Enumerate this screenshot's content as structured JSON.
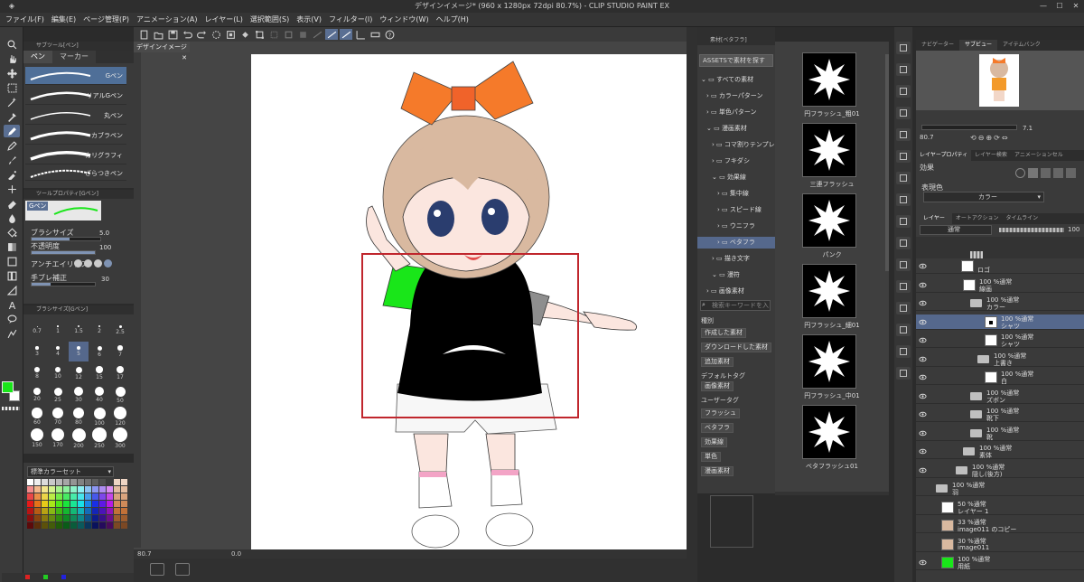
{
  "window": {
    "title": "デザインイメージ* (960 x 1280px 72dpi 80.7%)  - CLIP STUDIO PAINT EX"
  },
  "menu": [
    "ファイル(F)",
    "編集(E)",
    "ページ管理(P)",
    "アニメーション(A)",
    "レイヤー(L)",
    "選択範囲(S)",
    "表示(V)",
    "フィルター(I)",
    "ウィンドウ(W)",
    "ヘルプ(H)"
  ],
  "subtool": {
    "header": "サブツール[ペン]",
    "tabs": [
      "ペン",
      "マーカー"
    ],
    "brushes": [
      "Gペン",
      "リアルGペン",
      "丸ペン",
      "カブラペン",
      "カリグラフィ",
      "ざらつきペン"
    ]
  },
  "toolprop": {
    "header": "ツールプロパティ[Gペン]",
    "brush_name": "Gペン",
    "labels": {
      "size": "ブラシサイズ",
      "opacity": "不透明度",
      "aa": "アンチエイリアス",
      "stab": "手ブレ補正"
    },
    "values": {
      "size": "5.0",
      "opacity": "100",
      "stab": "30"
    },
    "fractions": {
      "size": 0.55,
      "opacity": 1.0,
      "stab": 0.3
    }
  },
  "brushsize": {
    "header": "ブラシサイズ[Gペン]",
    "sizes": [
      "0.7",
      "1",
      "1.5",
      "2",
      "2.5",
      "3",
      "4",
      "5",
      "6",
      "7",
      "8",
      "10",
      "12",
      "15",
      "17",
      "20",
      "25",
      "30",
      "40",
      "50",
      "60",
      "70",
      "80",
      "100",
      "120",
      "150",
      "170",
      "200",
      "250",
      "300"
    ]
  },
  "colorset": {
    "dropdown": "標準カラーセット"
  },
  "canvas": {
    "tab": "デザインイメージ*"
  },
  "status": {
    "zoom": "80.7",
    "angle": "0.0"
  },
  "colors": {
    "accent": "#5a6f93",
    "frame": "#c0262d",
    "mainColor": "#19e619"
  },
  "material": {
    "header": "素材[ベタフラ]",
    "assets_btn": "ASSETSで素材を探す",
    "tree": [
      {
        "label": "すべての素材",
        "indent": 0
      },
      {
        "label": "カラーパターン",
        "indent": 1
      },
      {
        "label": "単色パターン",
        "indent": 1
      },
      {
        "label": "漫画素材",
        "indent": 1
      },
      {
        "label": "コマ割りテンプレート",
        "indent": 2
      },
      {
        "label": "フキダシ",
        "indent": 2
      },
      {
        "label": "効果線",
        "indent": 2
      },
      {
        "label": "集中線",
        "indent": 3
      },
      {
        "label": "スピード線",
        "indent": 3
      },
      {
        "label": "ウニフラ",
        "indent": 3
      },
      {
        "label": "ベタフラ",
        "indent": 3
      },
      {
        "label": "描き文字",
        "indent": 2
      },
      {
        "label": "漫符",
        "indent": 2
      },
      {
        "label": "画像素材",
        "indent": 1
      }
    ],
    "search_placeholder": "検索キーワードを入",
    "kind_label": "種別",
    "kind_btns": [
      "作成した素材",
      "ダウンロードした素材",
      "追加素材"
    ],
    "default_tag_label": "デフォルトタグ",
    "default_tags": [
      "画像素材"
    ],
    "user_tag_label": "ユーザータグ",
    "user_tags": [
      "フラッシュ",
      "ベタフラ",
      "効果線",
      "単色",
      "漫画素材"
    ]
  },
  "thumbnails": [
    "円フラッシュ_粗01",
    "三連フラッシュ",
    "パンク",
    "円フラッシュ_細01",
    "円フラッシュ_中01",
    "ベタフラッシュ01"
  ],
  "navigator": {
    "tabs": [
      "ナビゲーター",
      "サブビュー",
      "アイテムバンク"
    ],
    "zoom": "80.7",
    "angle": "7.1"
  },
  "layerprop": {
    "tabs": [
      "レイヤープロパティ",
      "レイヤー検索",
      "アニメーションセル"
    ],
    "effect_label": "効果",
    "expr_label": "表現色",
    "expr_value": "カラー"
  },
  "layers": {
    "tabs": [
      "レイヤー",
      "オートアクション",
      "タイムライン"
    ],
    "blend": "通常",
    "opacity": "100",
    "rows": [
      {
        "top": "",
        "name": "ロゴ",
        "kind": "layer",
        "indent": 50,
        "eye": true
      },
      {
        "top": "100 %通常",
        "name": "線画",
        "kind": "layer",
        "indent": 52,
        "eye": true
      },
      {
        "top": "100 %通常",
        "name": "カラー",
        "kind": "folder",
        "indent": 60,
        "eye": true
      },
      {
        "top": "100 %通常",
        "name": "シャツ",
        "kind": "layer",
        "indent": 76,
        "eye": true,
        "on": true
      },
      {
        "top": "100 %通常",
        "name": "シャツ",
        "kind": "layer",
        "indent": 76,
        "eye": true
      },
      {
        "top": "100 %通常",
        "name": "上書き",
        "kind": "folder",
        "indent": 68,
        "eye": true
      },
      {
        "top": "100 %通常",
        "name": "白",
        "kind": "layer",
        "indent": 76,
        "eye": true
      },
      {
        "top": "100 %通常",
        "name": "ズボン",
        "kind": "folder",
        "indent": 60,
        "eye": true
      },
      {
        "top": "100 %通常",
        "name": "靴下",
        "kind": "folder",
        "indent": 60,
        "eye": true
      },
      {
        "top": "100 %通常",
        "name": "靴",
        "kind": "folder",
        "indent": 60,
        "eye": true
      },
      {
        "top": "100 %通常",
        "name": "素体",
        "kind": "folder",
        "indent": 52,
        "eye": true
      },
      {
        "top": "100 %通常",
        "name": "隠し(後方)",
        "kind": "folder",
        "indent": 44,
        "eye": true
      },
      {
        "top": "100 %通常",
        "name": "羽",
        "kind": "folder",
        "indent": 22,
        "eye": false
      },
      {
        "top": "50 %通常",
        "name": "レイヤー 1",
        "kind": "layer",
        "indent": 28,
        "eye": false
      },
      {
        "top": "33 %通常",
        "name": "image011 のコピー",
        "kind": "image",
        "indent": 28,
        "eye": false
      },
      {
        "top": "30 %通常",
        "name": "image011",
        "kind": "image",
        "indent": 28,
        "eye": false
      },
      {
        "top": "100 %通常",
        "name": "用紙",
        "kind": "paper",
        "indent": 28,
        "eye": true
      }
    ]
  }
}
